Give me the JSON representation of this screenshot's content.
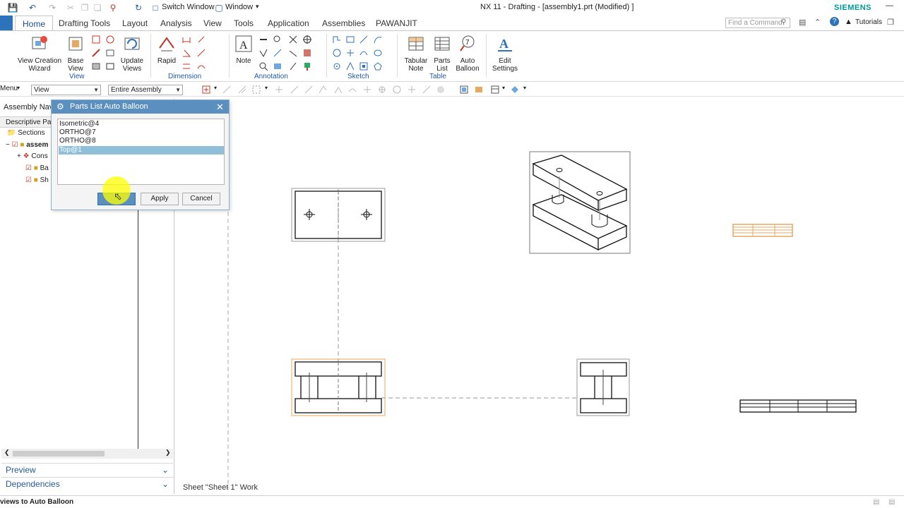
{
  "window": {
    "title": "NX 11 - Drafting - [assembly1.prt (Modified) ]",
    "brand": "SIEMENS",
    "switch_window": "Switch Window",
    "window_menu": "Window",
    "search_placeholder": "Find a Command",
    "tutorials": "Tutorials"
  },
  "tabs": [
    "Home",
    "Drafting Tools",
    "Layout",
    "Analysis",
    "View",
    "Tools",
    "Application",
    "Assemblies",
    "PAWANJIT"
  ],
  "ribbon": {
    "view_creation_wizard": [
      "View Creation",
      "Wizard"
    ],
    "base_view": [
      "Base",
      "View"
    ],
    "update_views": [
      "Update",
      "Views"
    ],
    "group_view": "View",
    "rapid": "Rapid",
    "group_dimension": "Dimension",
    "note": "Note",
    "group_annotation": "Annotation",
    "group_sketch": "Sketch",
    "tabular_note": [
      "Tabular",
      "Note"
    ],
    "parts_list": [
      "Parts",
      "List"
    ],
    "auto_balloon": [
      "Auto",
      "Balloon"
    ],
    "group_table": "Table",
    "edit_settings": [
      "Edit",
      "Settings"
    ]
  },
  "selbar": {
    "menu": "Menu",
    "filter": "View",
    "scope": "Entire Assembly"
  },
  "nav": {
    "header": "Assembly Navi",
    "column": "Descriptive Pa",
    "rows": [
      "Sections",
      "assem",
      "Cons",
      "Ba",
      "Sh"
    ],
    "preview": "Preview",
    "dependencies": "Dependencies"
  },
  "dialog": {
    "title": "Parts List Auto Balloon",
    "items": [
      "Isometric@4",
      "ORTHO@7",
      "ORTHO@8",
      "Top@1"
    ],
    "selected_index": 3,
    "apply": "Apply",
    "cancel": "Cancel"
  },
  "canvas": {
    "sheet_label": "Sheet \"Sheet 1\" Work"
  },
  "status": "views to Auto Balloon",
  "colors": {
    "accent": "#1f5aa6",
    "dialog_title": "#5b8fbf",
    "selection": "#8fbfd9",
    "highlight_orange": "#e8a860",
    "cursor_highlight": "#ffff00"
  }
}
